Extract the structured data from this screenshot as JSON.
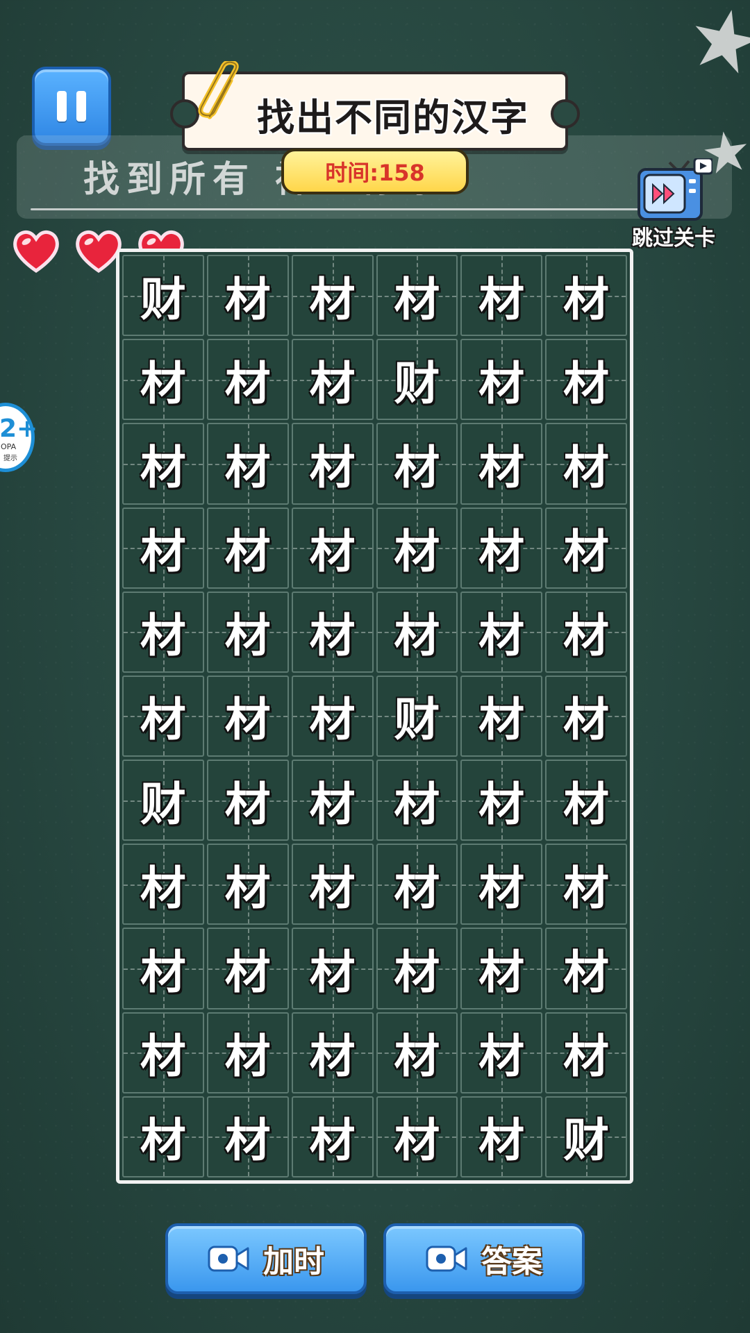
{
  "header": {
    "title": "找出不同的汉字",
    "instruction_visible": "找到所有 神到你家",
    "timer_label": "时间:158",
    "skip_label": "跳过关卡"
  },
  "lives": {
    "count": 3,
    "icon": "heart-icon"
  },
  "age_badge": {
    "rating": "2+",
    "line1": "OPA",
    "line2": "提示"
  },
  "grid": {
    "rows": 11,
    "cols": 6,
    "cells": [
      [
        "财",
        "材",
        "材",
        "材",
        "材",
        "材"
      ],
      [
        "材",
        "材",
        "材",
        "财",
        "材",
        "材"
      ],
      [
        "材",
        "材",
        "材",
        "材",
        "材",
        "材"
      ],
      [
        "材",
        "材",
        "材",
        "材",
        "材",
        "材"
      ],
      [
        "材",
        "材",
        "材",
        "材",
        "材",
        "材"
      ],
      [
        "材",
        "材",
        "材",
        "财",
        "材",
        "材"
      ],
      [
        "财",
        "材",
        "材",
        "材",
        "材",
        "材"
      ],
      [
        "材",
        "材",
        "材",
        "材",
        "材",
        "材"
      ],
      [
        "材",
        "材",
        "材",
        "材",
        "材",
        "材"
      ],
      [
        "材",
        "材",
        "材",
        "材",
        "材",
        "材"
      ],
      [
        "材",
        "材",
        "材",
        "材",
        "材",
        "财"
      ]
    ]
  },
  "buttons": {
    "add_time": "加时",
    "answer": "答案"
  },
  "colors": {
    "board_bg": "#24443b",
    "timer_text": "#d8342a",
    "button_blue": "#3a97ee"
  }
}
